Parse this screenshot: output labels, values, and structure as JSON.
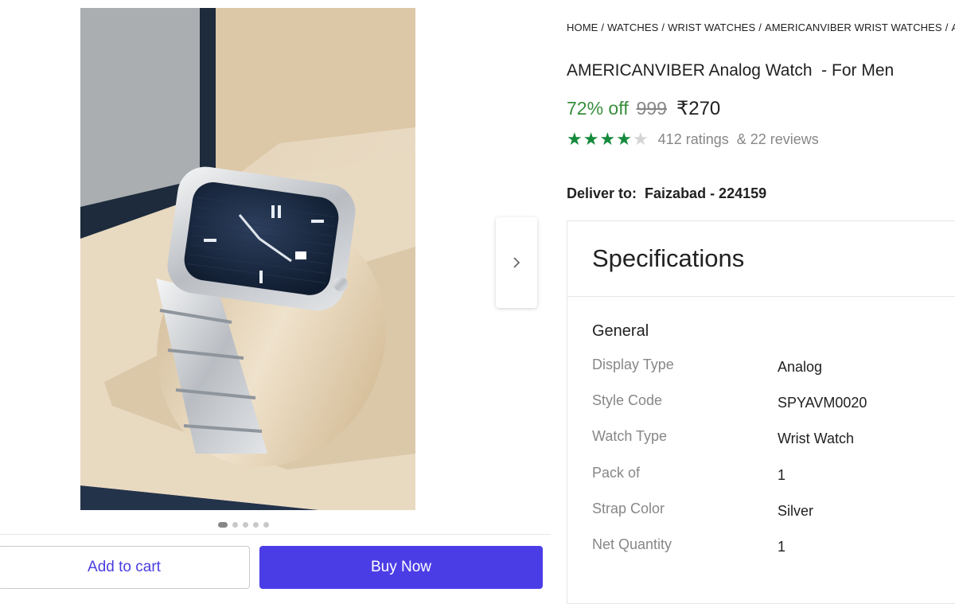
{
  "gallery": {
    "image_alt": "AMERICANVIBER Analog Watch",
    "dots_count": 5,
    "active_dot": 0
  },
  "breadcrumb": [
    "HOME",
    "WATCHES",
    "WRIST WATCHES",
    "AMERICANVIBER WRIST WATCHES",
    "AI"
  ],
  "product": {
    "title": "AMERICANVIBER Analog Watch  - For Men",
    "discount": "72% off",
    "mrp": "999",
    "price": "₹270",
    "rating_stars": 4,
    "ratings_text": "412 ratings",
    "reviews_text": "& 22 reviews"
  },
  "delivery": {
    "label": "Deliver to:",
    "location": "Faizabad - 224159"
  },
  "specifications": {
    "title": "Specifications",
    "section": "General",
    "rows": [
      {
        "key": "Display Type",
        "value": "Analog"
      },
      {
        "key": "Style Code",
        "value": "SPYAVM0020"
      },
      {
        "key": "Watch Type",
        "value": "Wrist Watch"
      },
      {
        "key": "Pack of",
        "value": "1"
      },
      {
        "key": "Strap Color",
        "value": "Silver"
      },
      {
        "key": "Net Quantity",
        "value": "1"
      }
    ]
  },
  "actions": {
    "add_to_cart": "Add to cart",
    "buy_now": "Buy Now"
  },
  "colors": {
    "primary": "#4b3de6",
    "discount_green": "#388e3c",
    "star_green": "#158a3b",
    "muted_gray": "#878787"
  },
  "icons": {
    "next": "chevron-right-icon",
    "star": "star-icon"
  }
}
